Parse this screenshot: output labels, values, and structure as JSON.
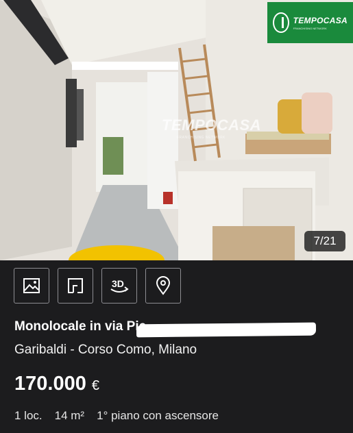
{
  "photo": {
    "logo": {
      "name": "TEMPOCASA",
      "tagline": "FRANCHISING NETWORK"
    },
    "watermark": {
      "name": "TEMPOCASA",
      "tagline": "FRANCHISING NETWORK"
    },
    "counter": "7/21"
  },
  "toolbar": {
    "items": [
      {
        "icon": "gallery-icon"
      },
      {
        "icon": "floorplan-icon"
      },
      {
        "icon": "3d-tour-icon",
        "label": "3D"
      },
      {
        "icon": "map-pin-icon"
      }
    ]
  },
  "listing": {
    "title": "Monolocale in via Pie",
    "location": "Garibaldi - Corso Como, Milano",
    "price": "170.000",
    "currency": "€",
    "rooms": "1 loc.",
    "area": "14 m²",
    "floor": "1° piano con ascensore"
  }
}
